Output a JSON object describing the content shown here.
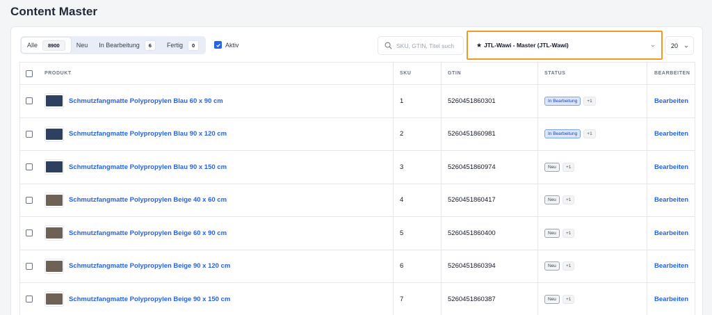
{
  "page": {
    "title": "Content Master"
  },
  "tabs": [
    {
      "label": "Alle",
      "count": "8900",
      "active": true
    },
    {
      "label": "Neu",
      "count": ""
    },
    {
      "label": "In Bearbeitung",
      "count": "6"
    },
    {
      "label": "Fertig",
      "count": "0"
    }
  ],
  "active_filter": {
    "label": "Aktiv",
    "checked": true
  },
  "search": {
    "placeholder": "SKU, GTIN, Titel such",
    "value": ""
  },
  "source_select": {
    "icon": "star-icon",
    "value": "JTL-Wawi - Master (JTL-Wawi)"
  },
  "per_page": {
    "value": "20"
  },
  "table": {
    "headers": {
      "product": "PRODUKT",
      "sku": "SKU",
      "gtin": "GTIN",
      "status": "STATUS",
      "edit": "BEARBEITEN"
    },
    "rows": [
      {
        "title": "Schmutzfangmatte Polypropylen Blau 60 x 90 cm",
        "sku": "1",
        "gtin": "5260451860301",
        "status": "In Bearbeitung",
        "status_type": "inwork",
        "extra": "+1",
        "edit": "Bearbeiten",
        "color": "#2f3f5f"
      },
      {
        "title": "Schmutzfangmatte Polypropylen Blau 90 x 120 cm",
        "sku": "2",
        "gtin": "5260451860981",
        "status": "In Bearbeitung",
        "status_type": "inwork",
        "extra": "+1",
        "edit": "Bearbeiten",
        "color": "#2f3f5f"
      },
      {
        "title": "Schmutzfangmatte Polypropylen Blau 90 x 150 cm",
        "sku": "3",
        "gtin": "5260451860974",
        "status": "Neu",
        "status_type": "new",
        "extra": "+1",
        "edit": "Bearbeiten",
        "color": "#2f3f5f"
      },
      {
        "title": "Schmutzfangmatte Polypropylen Beige 40 x 60 cm",
        "sku": "4",
        "gtin": "5260451860417",
        "status": "Neu",
        "status_type": "new",
        "extra": "+1",
        "edit": "Bearbeiten",
        "color": "#6e6257"
      },
      {
        "title": "Schmutzfangmatte Polypropylen Beige 60 x 90 cm",
        "sku": "5",
        "gtin": "5260451860400",
        "status": "Neu",
        "status_type": "new",
        "extra": "+1",
        "edit": "Bearbeiten",
        "color": "#6e6257"
      },
      {
        "title": "Schmutzfangmatte Polypropylen Beige 90 x 120 cm",
        "sku": "6",
        "gtin": "5260451860394",
        "status": "Neu",
        "status_type": "new",
        "extra": "+1",
        "edit": "Bearbeiten",
        "color": "#6e6257"
      },
      {
        "title": "Schmutzfangmatte Polypropylen Beige 90 x 150 cm",
        "sku": "7",
        "gtin": "5260451860387",
        "status": "Neu",
        "status_type": "new",
        "extra": "+1",
        "edit": "Bearbeiten",
        "color": "#6e6257"
      }
    ]
  },
  "colors": {
    "accent": "#2563eb",
    "highlight_border": "#f29a1f"
  }
}
